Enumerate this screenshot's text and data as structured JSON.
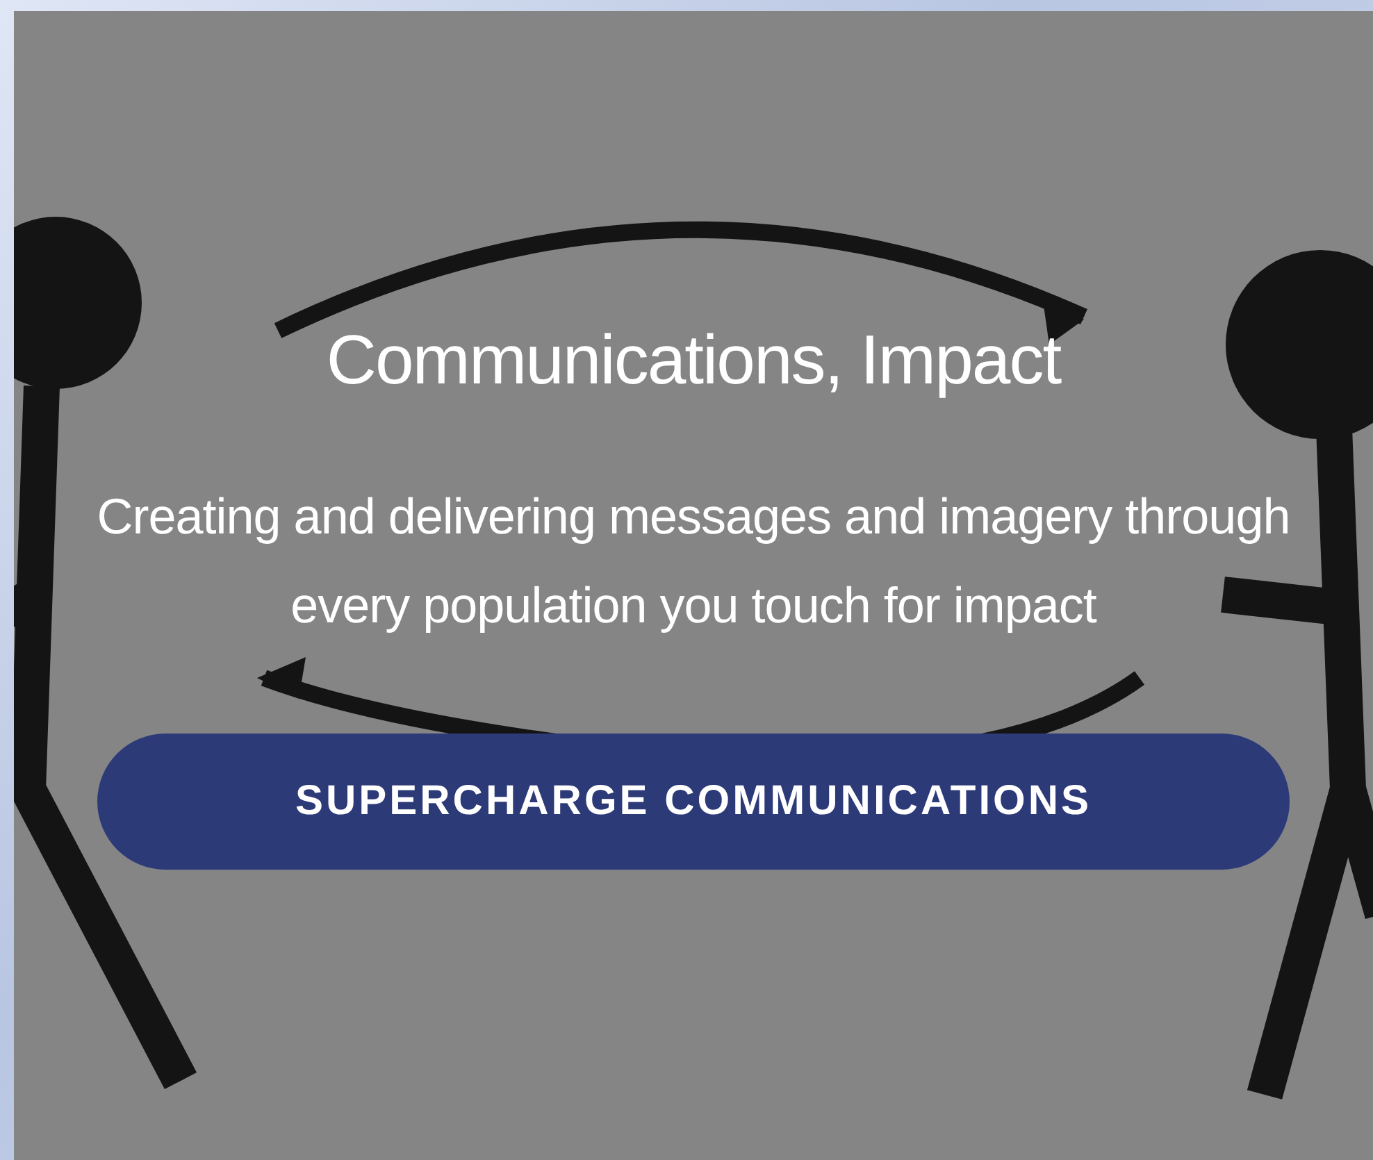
{
  "card": {
    "kind": "picture",
    "title": "Communications, Impact",
    "description": "Creating and delivering messages and imagery through every population you touch for impact",
    "button": "SUPERCHARGE COMMUNICATIONS"
  }
}
